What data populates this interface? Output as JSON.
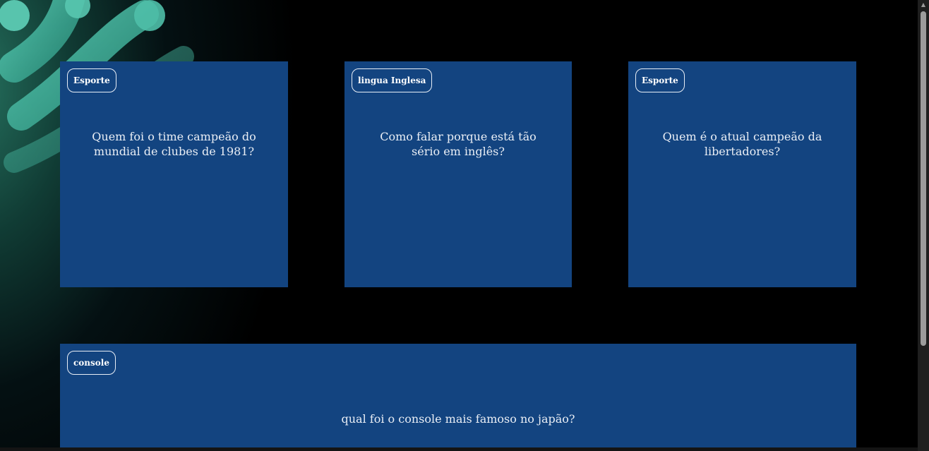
{
  "colors": {
    "background": "#000000",
    "card": "#134480",
    "card_text": "#e9eef5",
    "accent_glow": "#3bb39c"
  },
  "cards": [
    {
      "tag": "Esporte",
      "question": "Quem foi o time campeão do mundial de clubes de 1981?"
    },
    {
      "tag": "lingua Inglesa",
      "question": "Como falar porque está tão sério em inglês?"
    },
    {
      "tag": "Esporte",
      "question": "Quem é o atual campeão da libertadores?"
    },
    {
      "tag": "console",
      "question": "qual foi o console mais famoso no japão?"
    }
  ],
  "scrollbar": {
    "up_icon": "triangle-up-icon"
  }
}
